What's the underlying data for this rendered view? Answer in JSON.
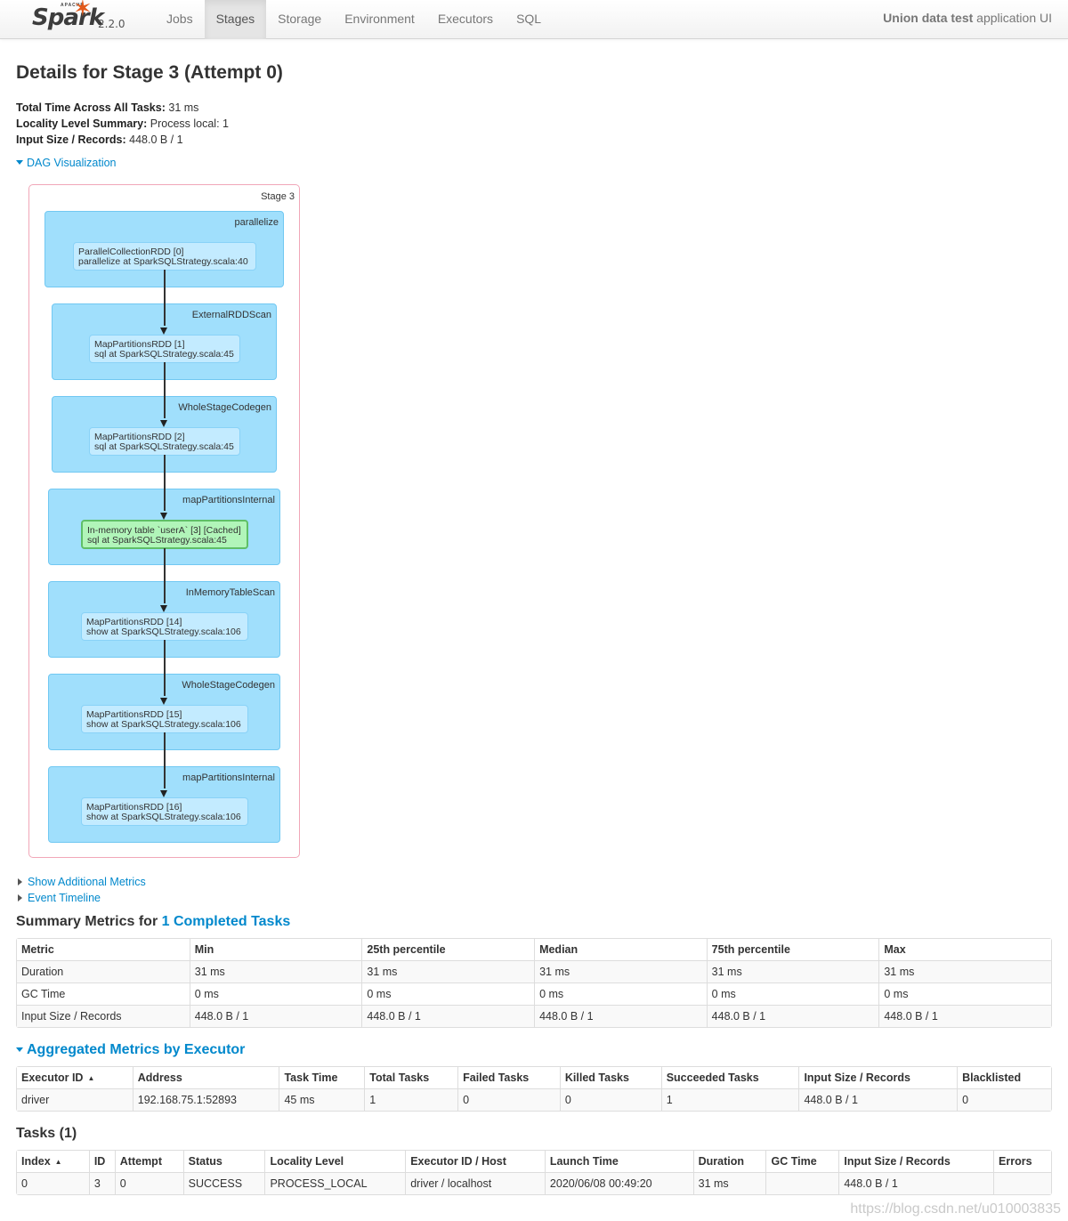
{
  "navbar": {
    "brand_apache": "APACHE",
    "brand_name": "Spark",
    "version": "2.2.0",
    "tabs": [
      {
        "label": "Jobs",
        "active": false
      },
      {
        "label": "Stages",
        "active": true
      },
      {
        "label": "Storage",
        "active": false
      },
      {
        "label": "Environment",
        "active": false
      },
      {
        "label": "Executors",
        "active": false
      },
      {
        "label": "SQL",
        "active": false
      }
    ],
    "app_name": "Union data test",
    "app_suffix": " application UI"
  },
  "page": {
    "title": "Details for Stage 3 (Attempt 0)",
    "summary": [
      {
        "label": "Total Time Across All Tasks:",
        "value": " 31 ms"
      },
      {
        "label": "Locality Level Summary:",
        "value": " Process local: 1"
      },
      {
        "label": "Input Size / Records:",
        "value": " 448.0 B / 1"
      }
    ],
    "dag_toggle": "DAG Visualization",
    "show_additional_metrics": "Show Additional Metrics",
    "event_timeline": "Event Timeline"
  },
  "dag": {
    "stage_label": "Stage 3",
    "clusters": [
      {
        "label": "parallelize",
        "rdd_name": "ParallelCollectionRDD [0]",
        "rdd_callsite": "parallelize at SparkSQLStrategy.scala:40",
        "cached": false
      },
      {
        "label": "ExternalRDDScan",
        "rdd_name": "MapPartitionsRDD [1]",
        "rdd_callsite": "sql at SparkSQLStrategy.scala:45",
        "cached": false
      },
      {
        "label": "WholeStageCodegen",
        "rdd_name": "MapPartitionsRDD [2]",
        "rdd_callsite": "sql at SparkSQLStrategy.scala:45",
        "cached": false
      },
      {
        "label": "mapPartitionsInternal",
        "rdd_name": "In-memory table `userA` [3] [Cached]",
        "rdd_callsite": "sql at SparkSQLStrategy.scala:45",
        "cached": true
      },
      {
        "label": "InMemoryTableScan",
        "rdd_name": "MapPartitionsRDD [14]",
        "rdd_callsite": "show at SparkSQLStrategy.scala:106",
        "cached": false
      },
      {
        "label": "WholeStageCodegen",
        "rdd_name": "MapPartitionsRDD [15]",
        "rdd_callsite": "show at SparkSQLStrategy.scala:106",
        "cached": false
      },
      {
        "label": "mapPartitionsInternal",
        "rdd_name": "MapPartitionsRDD [16]",
        "rdd_callsite": "show at SparkSQLStrategy.scala:106",
        "cached": false
      }
    ]
  },
  "summary_metrics": {
    "title_prefix": "Summary Metrics for ",
    "title_link": "1 Completed Tasks",
    "headers": [
      "Metric",
      "Min",
      "25th percentile",
      "Median",
      "75th percentile",
      "Max"
    ],
    "rows": [
      [
        "Duration",
        "31 ms",
        "31 ms",
        "31 ms",
        "31 ms",
        "31 ms"
      ],
      [
        "GC Time",
        "0 ms",
        "0 ms",
        "0 ms",
        "0 ms",
        "0 ms"
      ],
      [
        "Input Size / Records",
        "448.0 B / 1",
        "448.0 B / 1",
        "448.0 B / 1",
        "448.0 B / 1",
        "448.0 B / 1"
      ]
    ]
  },
  "executor_metrics": {
    "title": "Aggregated Metrics by Executor",
    "sort_indicator": "▲",
    "headers": [
      "Executor ID",
      "Address",
      "Task Time",
      "Total Tasks",
      "Failed Tasks",
      "Killed Tasks",
      "Succeeded Tasks",
      "Input Size / Records",
      "Blacklisted"
    ],
    "rows": [
      [
        "driver",
        "192.168.75.1:52893",
        "45 ms",
        "1",
        "0",
        "0",
        "1",
        "448.0 B / 1",
        "0"
      ]
    ]
  },
  "tasks": {
    "title": "Tasks (1)",
    "sort_indicator": "▲",
    "headers": [
      "Index",
      "ID",
      "Attempt",
      "Status",
      "Locality Level",
      "Executor ID / Host",
      "Launch Time",
      "Duration",
      "GC Time",
      "Input Size / Records",
      "Errors"
    ],
    "rows": [
      [
        "0",
        "3",
        "0",
        "SUCCESS",
        "PROCESS_LOCAL",
        "driver / localhost",
        "2020/06/08 00:49:20",
        "31 ms",
        "",
        "448.0 B / 1",
        ""
      ]
    ]
  },
  "watermark": "https://blog.csdn.net/u010003835"
}
